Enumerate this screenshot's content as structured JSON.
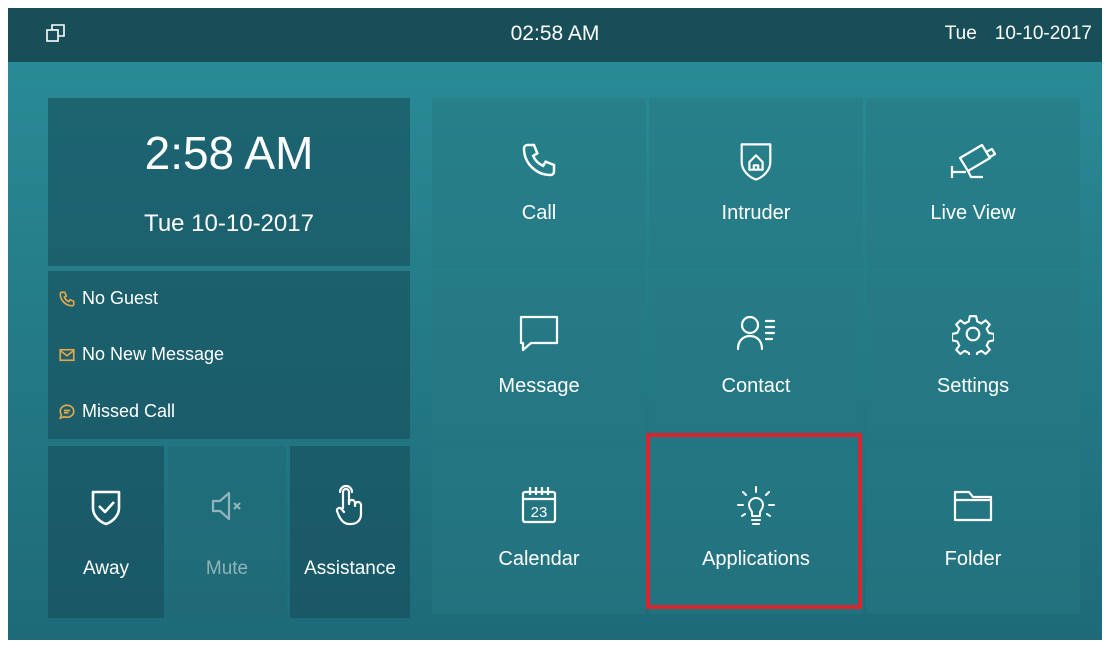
{
  "status_bar": {
    "time": "02:58 AM",
    "day": "Tue",
    "date": "10-10-2017",
    "icon": "windows-icon"
  },
  "clock_panel": {
    "time": "2:58 AM",
    "date": "Tue 10-10-2017"
  },
  "notifications": [
    {
      "icon": "phone-icon",
      "label": "No Guest"
    },
    {
      "icon": "envelope-icon",
      "label": "No New Message"
    },
    {
      "icon": "chat-bubble-icon",
      "label": "Missed Call"
    }
  ],
  "quick_buttons": [
    {
      "icon": "shield-check-icon",
      "label": "Away"
    },
    {
      "icon": "speaker-mute-icon",
      "label": "Mute",
      "state": "disabled"
    },
    {
      "icon": "pointing-hand-icon",
      "label": "Assistance"
    }
  ],
  "apps": [
    {
      "icon": "phone-icon",
      "label": "Call"
    },
    {
      "icon": "shield-home-icon",
      "label": "Intruder"
    },
    {
      "icon": "camera-icon",
      "label": "Live View"
    },
    {
      "icon": "message-icon",
      "label": "Message"
    },
    {
      "icon": "contact-icon",
      "label": "Contact"
    },
    {
      "icon": "gear-icon",
      "label": "Settings"
    },
    {
      "icon": "calendar-icon",
      "label": "Calendar",
      "calendar_day": "23"
    },
    {
      "icon": "lightbulb-icon",
      "label": "Applications"
    },
    {
      "icon": "folder-icon",
      "label": "Folder"
    }
  ],
  "colors": {
    "status_bar": "#174e58",
    "screen_background": "#257f8b",
    "highlight_border": "#d9262e",
    "notification_icon": "#e0a84a",
    "muted_text": "#8fb4bb"
  }
}
